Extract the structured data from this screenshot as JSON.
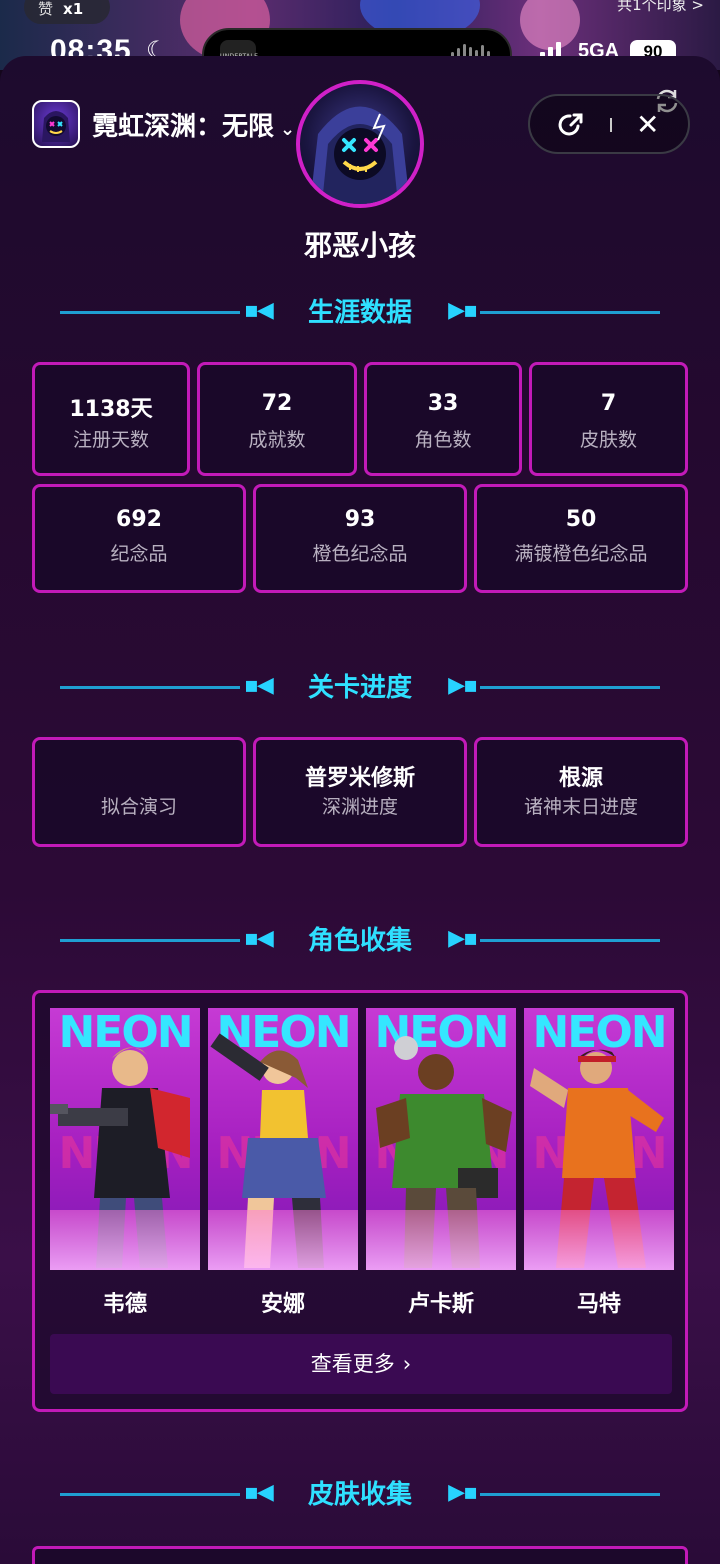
{
  "top_overlay": {
    "pill_text": "赞",
    "pill_badge": "x1",
    "right_link": "共1个印象 >"
  },
  "status_bar": {
    "time": "08:35",
    "network": "5GA",
    "battery": "90",
    "island_app_label": "UNDERTALE"
  },
  "header": {
    "game_title": "霓虹深渊：无限",
    "title_chevron": "⌄",
    "close_glyph": "✕",
    "username": "邪恶小孩"
  },
  "career": {
    "title": "生涯数据",
    "stats_row1": [
      {
        "value": "1138天",
        "label": "注册天数"
      },
      {
        "value": "72",
        "label": "成就数"
      },
      {
        "value": "33",
        "label": "角色数"
      },
      {
        "value": "7",
        "label": "皮肤数"
      }
    ],
    "stats_row2": [
      {
        "value": "692",
        "label": "纪念品"
      },
      {
        "value": "93",
        "label": "橙色纪念品"
      },
      {
        "value": "50",
        "label": "满镀橙色纪念品"
      }
    ]
  },
  "progress": {
    "title": "关卡进度",
    "items": [
      {
        "value": "",
        "label": "拟合演习"
      },
      {
        "value": "普罗米修斯",
        "label": "深渊进度"
      },
      {
        "value": "根源",
        "label": "诸神末日进度"
      }
    ]
  },
  "characters": {
    "title": "角色收集",
    "card_text": "NEON",
    "items": [
      {
        "name": "韦德"
      },
      {
        "name": "安娜"
      },
      {
        "name": "卢卡斯"
      },
      {
        "name": "马特"
      }
    ],
    "more_label": "查看更多",
    "more_arrow": "›"
  },
  "skins": {
    "title": "皮肤收集"
  },
  "colors": {
    "accent_cyan": "#2fe0ff",
    "border_magenta": "#c21ab8",
    "background": "#1d0b2e"
  }
}
